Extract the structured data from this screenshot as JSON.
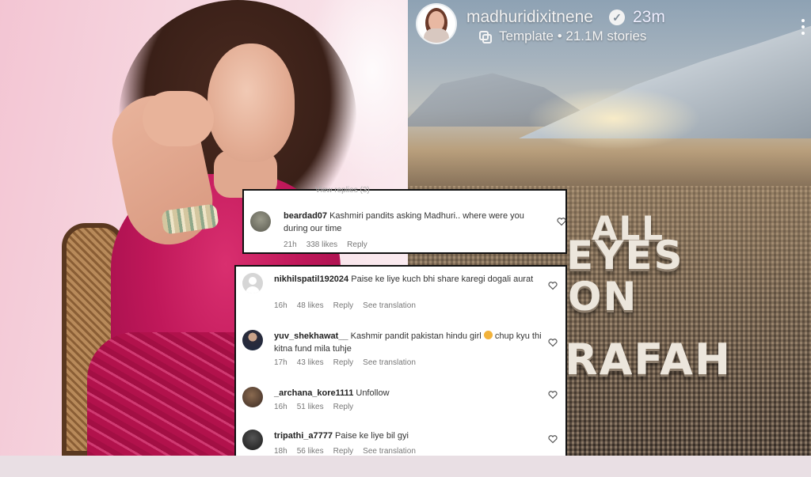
{
  "story": {
    "username": "madhuridixitnene",
    "time": "23m",
    "template_label": "Template • 21.1M stories",
    "image_text": [
      "ALL",
      "EYES",
      "ON",
      "RAFAH"
    ],
    "icons": {
      "verified": "verified-badge-icon",
      "template": "template-icon",
      "more": "more-vertical-icon"
    }
  },
  "top_comment": {
    "previous_hint": "View replies (3)",
    "username": "beardad07",
    "text": "Kashmiri pandits asking Madhuri.. where were you during our time",
    "time": "21h",
    "likes": "338 likes",
    "reply": "Reply"
  },
  "comments": [
    {
      "username": "nikhilspatil192024",
      "text": "Paise ke liye kuch bhi share karegi dogali aurat",
      "time": "16h",
      "likes": "48 likes",
      "reply": "Reply",
      "translate": "See translation"
    },
    {
      "username": "yuv_shekhawat__",
      "text": "Kashmir pandit pakistan hindu girl",
      "text2": "chup kyu thi kitna fund mila tuhje",
      "time": "17h",
      "likes": "43 likes",
      "reply": "Reply",
      "translate": "See translation"
    },
    {
      "username": "_archana_kore1111",
      "text": "Unfollow",
      "time": "16h",
      "likes": "51 likes",
      "reply": "Reply"
    },
    {
      "username": "tripathi_a7777",
      "text": "Paise ke liye bil gyi",
      "time": "18h",
      "likes": "56 likes",
      "reply": "Reply",
      "translate": "See translation"
    }
  ],
  "colors": {
    "accent_pink": "#c0185a",
    "card_border": "#111111",
    "meta_grey": "#777777"
  }
}
